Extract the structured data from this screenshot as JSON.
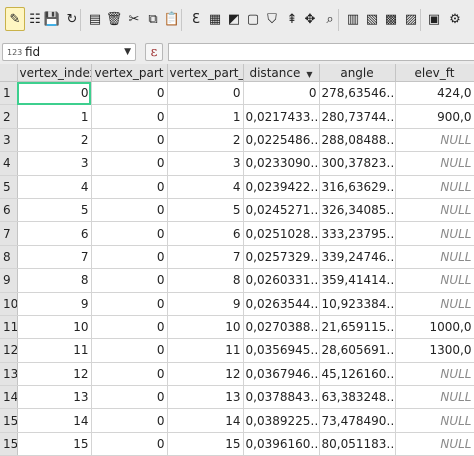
{
  "toolbar": {
    "buttons": [
      {
        "name": "toggle-editing-icon",
        "glyph": "✎",
        "active": true
      },
      {
        "name": "multi-edit-icon",
        "glyph": "☷"
      },
      {
        "name": "save-edits-icon",
        "glyph": "💾"
      },
      {
        "name": "reload-icon",
        "glyph": "↻"
      },
      {
        "name": "add-feature-icon",
        "glyph": "▤"
      },
      {
        "name": "delete-feature-icon",
        "glyph": "🗑"
      },
      {
        "name": "cut-icon",
        "glyph": "✂"
      },
      {
        "name": "copy-icon",
        "glyph": "⧉"
      },
      {
        "name": "paste-icon",
        "glyph": "📋"
      },
      {
        "name": "select-by-expression-icon",
        "glyph": "Ɛ"
      },
      {
        "name": "select-all-icon",
        "glyph": "▦"
      },
      {
        "name": "invert-selection-icon",
        "glyph": "◩"
      },
      {
        "name": "deselect-all-icon",
        "glyph": "▢"
      },
      {
        "name": "filter-selection-icon",
        "glyph": "⛉"
      },
      {
        "name": "move-selection-to-top-icon",
        "glyph": "⇞"
      },
      {
        "name": "pan-to-selected-icon",
        "glyph": "✥"
      },
      {
        "name": "zoom-to-selected-icon",
        "glyph": "⌕"
      },
      {
        "name": "new-field-icon",
        "glyph": "▥"
      },
      {
        "name": "delete-field-icon",
        "glyph": "▧"
      },
      {
        "name": "field-calculator-icon",
        "glyph": "▩"
      },
      {
        "name": "conditional-formatting-icon",
        "glyph": "▨"
      },
      {
        "name": "dock-toggle-icon",
        "glyph": "▣"
      },
      {
        "name": "actions-icon",
        "glyph": "⚙"
      }
    ]
  },
  "filter": {
    "field_type": "123",
    "field_name": "fid",
    "expression_glyph": "ε",
    "value": ""
  },
  "table": {
    "columns": [
      "vertex_index",
      "vertex_part",
      "vertex_part_index",
      "distance",
      "angle",
      "elev_ft"
    ],
    "sorted_column": "distance",
    "rows": [
      {
        "id": "1",
        "cells": [
          "0",
          "0",
          "0",
          "0",
          "278,63546…",
          "424,0"
        ]
      },
      {
        "id": "2",
        "cells": [
          "1",
          "0",
          "1",
          "0,0217433…",
          "280,73744…",
          "900,0"
        ]
      },
      {
        "id": "3",
        "cells": [
          "2",
          "0",
          "2",
          "0,0225486…",
          "288,08488…",
          "NULL"
        ]
      },
      {
        "id": "4",
        "cells": [
          "3",
          "0",
          "3",
          "0,0233090…",
          "300,37823…",
          "NULL"
        ]
      },
      {
        "id": "5",
        "cells": [
          "4",
          "0",
          "4",
          "0,0239422…",
          "316,63629…",
          "NULL"
        ]
      },
      {
        "id": "6",
        "cells": [
          "5",
          "0",
          "5",
          "0,0245271…",
          "326,34085…",
          "NULL"
        ]
      },
      {
        "id": "7",
        "cells": [
          "6",
          "0",
          "6",
          "0,0251028…",
          "333,23795…",
          "NULL"
        ]
      },
      {
        "id": "8",
        "cells": [
          "7",
          "0",
          "7",
          "0,0257329…",
          "339,24746…",
          "NULL"
        ]
      },
      {
        "id": "9",
        "cells": [
          "8",
          "0",
          "8",
          "0,0260331…",
          "359,41414…",
          "NULL"
        ]
      },
      {
        "id": "10",
        "cells": [
          "9",
          "0",
          "9",
          "0,0263544…",
          "10,923384…",
          "NULL"
        ]
      },
      {
        "id": "11",
        "cells": [
          "10",
          "0",
          "10",
          "0,0270388…",
          "21,659115…",
          "1000,0"
        ]
      },
      {
        "id": "12",
        "cells": [
          "11",
          "0",
          "11",
          "0,0356945…",
          "28,605691…",
          "1300,0"
        ]
      },
      {
        "id": "13",
        "cells": [
          "12",
          "0",
          "12",
          "0,0367946…",
          "45,126160…",
          "NULL"
        ]
      },
      {
        "id": "14",
        "cells": [
          "13",
          "0",
          "13",
          "0,0378843…",
          "63,383248…",
          "NULL"
        ]
      },
      {
        "id": "15",
        "cells": [
          "14",
          "0",
          "14",
          "0,0389225…",
          "73,478490…",
          "NULL"
        ]
      },
      {
        "id": "15",
        "cells": [
          "15",
          "0",
          "15",
          "0,0396160…",
          "80,051183…",
          "NULL"
        ]
      }
    ]
  },
  "colors": {
    "selected_cell_outline": "#3dcf8e",
    "null_text": "#8a8a8a"
  }
}
